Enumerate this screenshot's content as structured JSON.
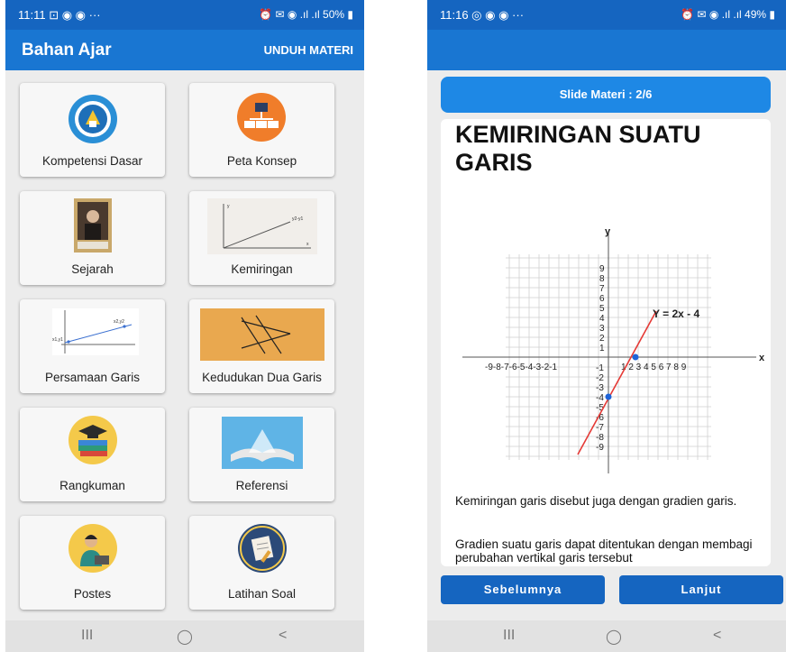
{
  "left": {
    "status": {
      "time": "11:11 ⊡ ◉ ◉ ···",
      "right": "⏰ ✉ ◉ .ıl .ıl 50% ▮"
    },
    "appbar": {
      "title": "Bahan Ajar",
      "action": "UNDUH MATERI"
    },
    "menu": [
      {
        "label": "Kompetensi Dasar",
        "icon": "tut-wuri-logo-icon"
      },
      {
        "label": "Peta Konsep",
        "icon": "concept-map-icon"
      },
      {
        "label": "Sejarah",
        "icon": "portrait-image-icon"
      },
      {
        "label": "Kemiringan",
        "icon": "slope-graph-icon"
      },
      {
        "label": "Persamaan Garis",
        "icon": "line-equation-graph-icon"
      },
      {
        "label": "Kedudukan Dua Garis",
        "icon": "intersecting-lines-icon"
      },
      {
        "label": "Rangkuman",
        "icon": "graduation-books-icon"
      },
      {
        "label": "Referensi",
        "icon": "open-book-icon"
      },
      {
        "label": "Postes",
        "icon": "teacher-laptop-icon"
      },
      {
        "label": "Latihan Soal",
        "icon": "exam-paper-icon"
      }
    ],
    "graph_slope_labels": {
      "y": "y",
      "x": "x",
      "line": "y2-y1"
    },
    "graph_line_labels": {
      "p1": "x1,y1",
      "p2": "x2,y2"
    },
    "nav": {
      "recent": "III",
      "home": "◯",
      "back": "<"
    }
  },
  "right": {
    "status": {
      "time": "11:16 ◎ ◉ ◉ ···",
      "right": "⏰ ✉ ◉ .ıl .ıl 49% ▮"
    },
    "slide_label": "Slide Materi : 2/6",
    "heading": "KEMIRINGAN SUATU GARIS",
    "graph": {
      "y_axis": "y",
      "x_axis": "x",
      "equation": "Y = 2x - 4",
      "x_ticks_neg": "-9-8-7-6-5-4-3-2-1",
      "x_ticks_pos": "1 2 3 4 5 6 7 8 9",
      "y_ticks_pos": [
        "9",
        "8",
        "7",
        "6",
        "5",
        "4",
        "3",
        "2",
        "1"
      ],
      "y_ticks_neg": [
        "-1",
        "-2",
        "-3",
        "-4",
        "-5",
        "-6",
        "-7",
        "-8",
        "-9"
      ],
      "points": [
        {
          "x": 2,
          "y": 0
        },
        {
          "x": 0,
          "y": -4
        }
      ]
    },
    "para1": "Kemiringan garis disebut juga dengan gradien garis.",
    "para2": "Gradien suatu garis dapat ditentukan dengan membagi perubahan vertikal garis tersebut",
    "prev_button": "Sebelumnya",
    "next_button": "Lanjut",
    "nav": {
      "recent": "III",
      "home": "◯",
      "back": "<"
    }
  }
}
